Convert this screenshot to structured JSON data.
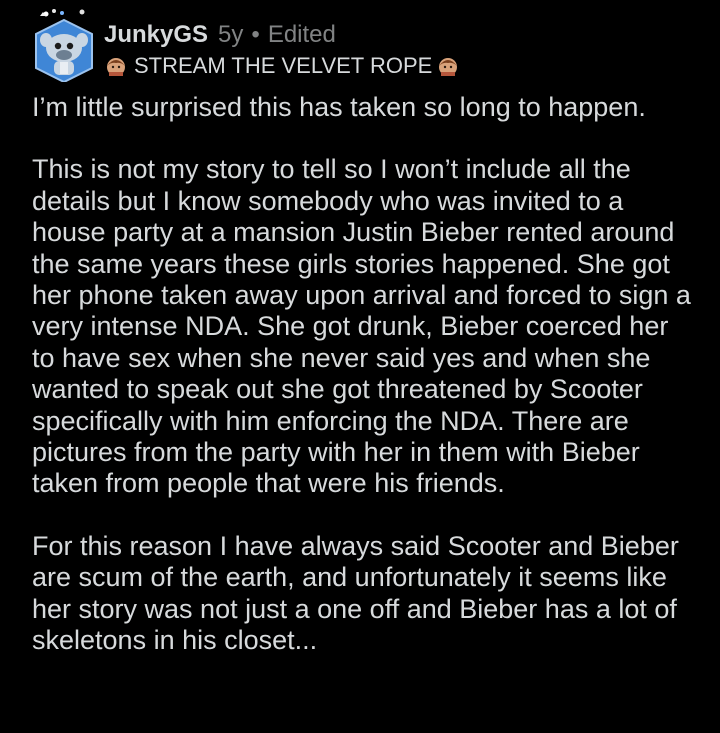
{
  "comment": {
    "username": "JunkyGS",
    "age": "5y",
    "separator": "•",
    "edited": "Edited",
    "flair": "STREAM THE VELVET ROPE",
    "paragraphs": [
      "I’m little surprised this has taken so long to happen.",
      "This is not my story to tell so I won’t include all the details but I know somebody who was invited to a house party at a mansion Justin Bieber rented around the same years these girls stories happened. She got her phone taken away upon arrival and forced to sign a very intense NDA. She got drunk, Bieber coerced her to have sex when she never said yes and when she wanted to speak out she got threatened by Scooter specifically with him enforcing the NDA. There are pictures from the party with her in them with Bieber taken from people that were his friends.",
      "For this reason I have always said Scooter and Bieber are scum of the earth, and unfortunately it seems like her story was not just a one off and Bieber has a lot of skeletons in his closet..."
    ]
  },
  "icons": {
    "avatar": "snoo-avatar-icon",
    "flair_left": "flair-emoji-icon",
    "flair_right": "flair-emoji-icon"
  },
  "colors": {
    "background": "#000000",
    "text": "#d7dadc",
    "meta": "#818384",
    "avatar_bg": "#3f86d6"
  }
}
